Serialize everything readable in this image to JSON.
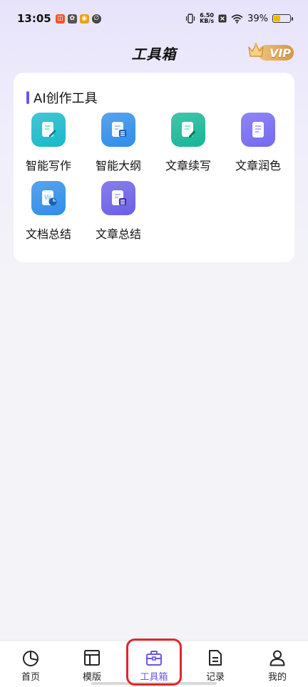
{
  "status_bar": {
    "time": "13:05",
    "net_speed_value": "6.50",
    "net_speed_unit": "KB/s",
    "battery_percent": "39%",
    "battery_level": 0.39
  },
  "header": {
    "title": "工具箱",
    "vip_label": "VIP"
  },
  "tool_card": {
    "title": "AI创作工具",
    "tools": [
      {
        "label": "智能写作",
        "icon": "pen-document-icon",
        "color": "#17b8c9"
      },
      {
        "label": "智能大纲",
        "icon": "outline-document-icon",
        "color": "#2f8de8"
      },
      {
        "label": "文章续写",
        "icon": "continue-writing-icon",
        "color": "#17b597"
      },
      {
        "label": "文章润色",
        "icon": "polish-document-icon",
        "color": "#7468f0"
      },
      {
        "label": "文档总结",
        "icon": "word-summary-icon",
        "color": "#2f8de8"
      },
      {
        "label": "文章总结",
        "icon": "article-summary-icon",
        "color": "#6a5fe6"
      }
    ]
  },
  "bottom_nav": {
    "items": [
      {
        "label": "首页",
        "icon": "pie-chart-icon",
        "active": false
      },
      {
        "label": "模版",
        "icon": "template-layout-icon",
        "active": false
      },
      {
        "label": "工具箱",
        "icon": "toolbox-icon",
        "active": true
      },
      {
        "label": "记录",
        "icon": "record-document-icon",
        "active": false
      },
      {
        "label": "我的",
        "icon": "user-icon",
        "active": false
      }
    ]
  },
  "colors": {
    "accent": "#6b55e8",
    "highlight_border": "#e3242b",
    "vip_gold": "#d7954a"
  }
}
